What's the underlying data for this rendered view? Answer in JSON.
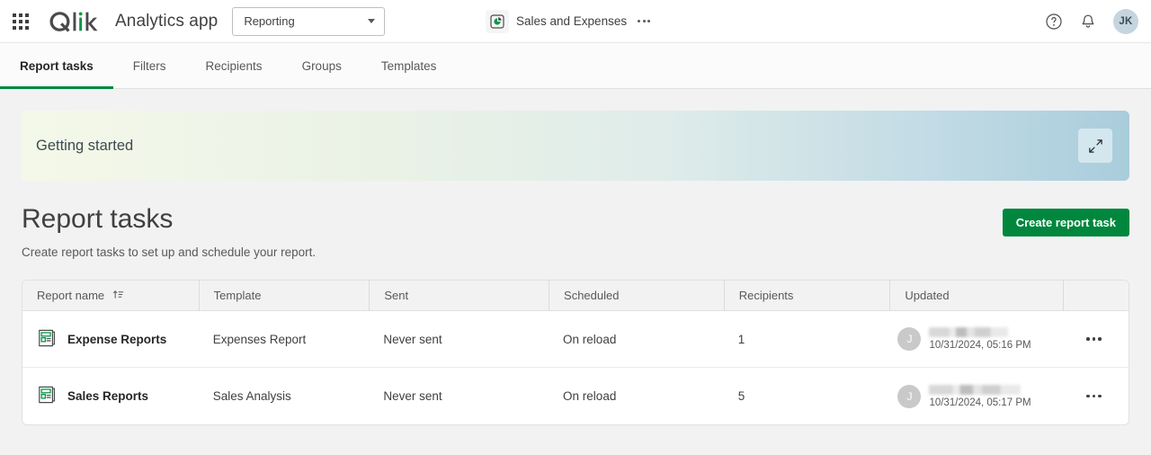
{
  "topbar": {
    "waffle_icon": "apps-grid-icon",
    "logo_text": "Qlik",
    "app_title": "Analytics app",
    "section_select": {
      "value": "Reporting",
      "options": [
        "Reporting"
      ]
    },
    "document": {
      "icon": "pie-chart-doc-icon",
      "name": "Sales and Expenses",
      "overflow": "..."
    },
    "help_icon": "question-circle-icon",
    "notifications_icon": "bell-icon",
    "avatar_initials": "JK"
  },
  "tabs": [
    {
      "label": "Report tasks",
      "active": true
    },
    {
      "label": "Filters",
      "active": false
    },
    {
      "label": "Recipients",
      "active": false
    },
    {
      "label": "Groups",
      "active": false
    },
    {
      "label": "Templates",
      "active": false
    }
  ],
  "banner": {
    "title": "Getting started",
    "expand_icon": "expand-diagonal-icon"
  },
  "page": {
    "title": "Report tasks",
    "subtitle": "Create report tasks to set up and schedule your report.",
    "create_button": "Create report task"
  },
  "table": {
    "columns": [
      {
        "label": "Report name",
        "sort_icon": "sort-ascending-icon"
      },
      {
        "label": "Template"
      },
      {
        "label": "Sent"
      },
      {
        "label": "Scheduled"
      },
      {
        "label": "Recipients"
      },
      {
        "label": "Updated"
      },
      {
        "label": ""
      }
    ],
    "rows": [
      {
        "icon": "report-document-icon",
        "name": "Expense Reports",
        "template": "Expenses Report",
        "sent": "Never sent",
        "scheduled": "On reload",
        "recipients": "1",
        "updated_by_initial": "J",
        "updated_by_name": "",
        "updated_time": "10/31/2024, 05:16 PM",
        "menu": "..."
      },
      {
        "icon": "report-document-icon",
        "name": "Sales Reports",
        "template": "Sales Analysis",
        "sent": "Never sent",
        "scheduled": "On reload",
        "recipients": "5",
        "updated_by_initial": "J",
        "updated_by_name": "",
        "updated_time": "10/31/2024, 05:17 PM",
        "menu": "..."
      }
    ]
  },
  "colors": {
    "brand_green": "#00873d",
    "banner_start": "#f4f8e9",
    "banner_end": "#a9cddc",
    "page_bg": "#f2f2f2"
  }
}
